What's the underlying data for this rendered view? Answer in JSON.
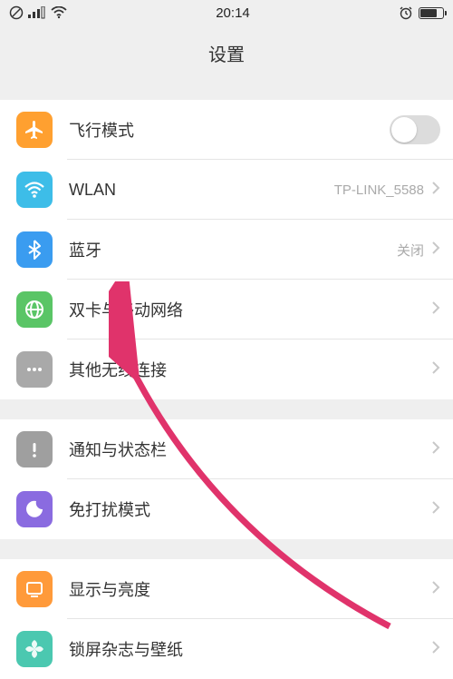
{
  "status": {
    "time": "20:14"
  },
  "header": {
    "title": "设置"
  },
  "items": {
    "airplane": "飞行模式",
    "wlan": "WLAN",
    "wlan_value": "TP-LINK_5588",
    "bluetooth": "蓝牙",
    "bluetooth_value": "关闭",
    "dualsim": "双卡与移动网络",
    "other_wireless": "其他无线连接",
    "notifications": "通知与状态栏",
    "dnd": "免打扰模式",
    "display": "显示与亮度",
    "lockscreen": "锁屏杂志与壁纸"
  }
}
